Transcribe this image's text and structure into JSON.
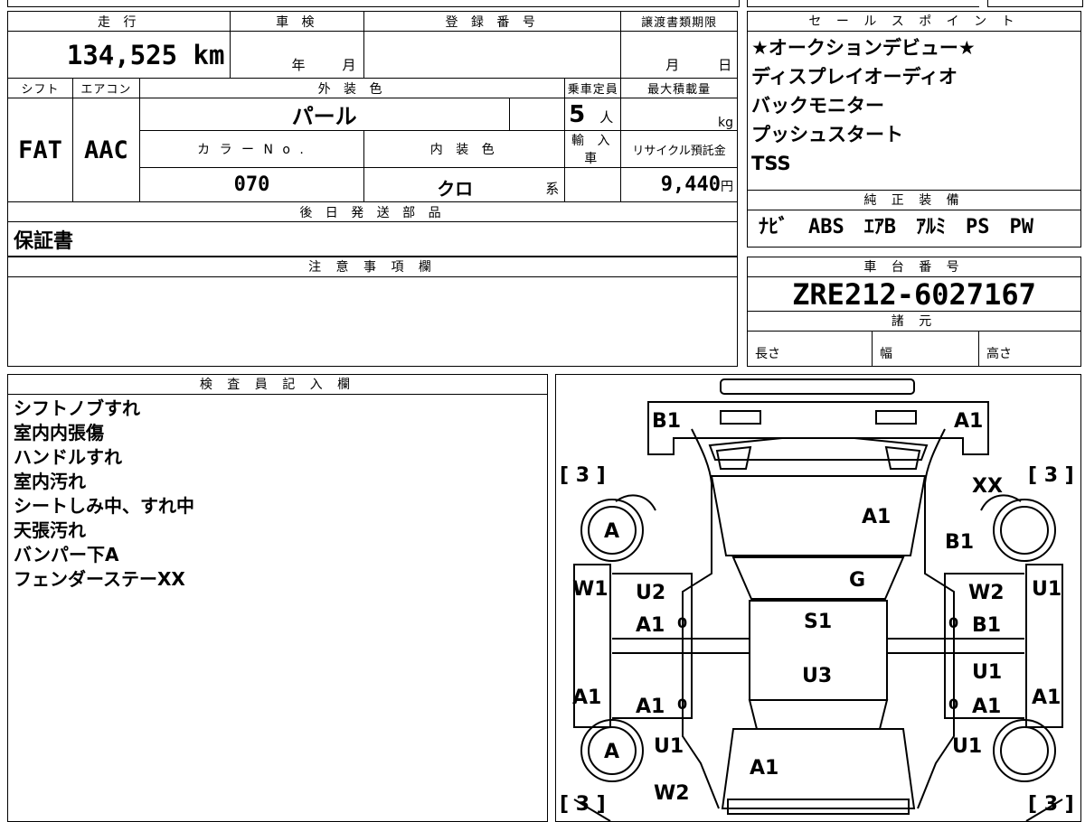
{
  "vehicle": {
    "labels": {
      "mileage": "走 行",
      "inspection": "車 検",
      "registration": "登 録 番 号",
      "transfer_deadline": "譲渡書類期限",
      "shift": "シフト",
      "aircon": "エアコン",
      "exterior_color": "外 装 色",
      "capacity": "乗車定員",
      "max_load": "最大積載量",
      "color_no": "カ ラ ー N o .",
      "interior_color": "内 装 色",
      "import": "輸 入 車",
      "recycle": "リサイクル預託金",
      "later_parts": "後 日 発 送 部 品"
    },
    "mileage": "134,525 km",
    "inspection_year": "年",
    "inspection_month": "月",
    "deadline_month": "月",
    "deadline_day": "日",
    "shift": "FAT",
    "aircon": "AAC",
    "exterior_color": "パール",
    "capacity_value": "5",
    "capacity_unit": "人",
    "max_load_unit": "kg",
    "color_no": "070",
    "interior_color": "クロ",
    "interior_suffix": "系",
    "recycle_value": "9,440",
    "recycle_unit": "円",
    "later_parts": "保証書"
  },
  "sales_points": {
    "header": "セ ー ル ス ポ イ ン ト",
    "items": [
      "★オークションデビュー★",
      "ディスプレイオーディオ",
      "バックモニター",
      "プッシュスタート",
      "TSS"
    ]
  },
  "equipment": {
    "header": "純 正 装 備",
    "text": "ﾅﾋﾞ　ABS　ｴｱB　ｱﾙﾐ　PS　PW"
  },
  "notes": {
    "header": "注 意 事 項 欄"
  },
  "chassis": {
    "header": "車 台 番 号",
    "number": "ZRE212-6027167",
    "specs_header": "諸 元",
    "length_label": "長さ",
    "width_label": "幅",
    "height_label": "高さ"
  },
  "inspector": {
    "header": "検 査 員 記 入 欄",
    "lines": [
      "シフトノブすれ",
      "室内内張傷",
      "ハンドルすれ",
      "室内汚れ",
      "シートしみ中、すれ中",
      "天張汚れ",
      "バンパー下A",
      "フェンダーステーXX"
    ]
  },
  "diagram": {
    "bracket_tl": "[ 3 ]",
    "bracket_tr": "[ 3 ]",
    "bracket_bl": "[ 3 ]",
    "bracket_br": "[ 3 ]",
    "front_left": "B1",
    "front_right": "A1",
    "xx": "XX",
    "hood": "A1",
    "fender_r": "B1",
    "wheel_fl": "A",
    "wheel_rl": "A",
    "windshield": "G",
    "w1": "W1",
    "u2": "U2",
    "a1_fl_door": "A1",
    "w2_r": "W2",
    "b1_fr_door": "B1",
    "u1_r": "U1",
    "roof": "S1",
    "u3": "U3",
    "a1_left": "A1",
    "a1_rl_door": "A1",
    "u1_rr_door": "U1",
    "a1_rr_door": "A1",
    "a1_right": "A1",
    "u1_l_rear": "U1",
    "u1_r_rear": "U1",
    "trunk": "A1",
    "w2_bottom": "W2",
    "zero1": "0",
    "zero2": "0",
    "zero3": "0",
    "zero4": "0"
  }
}
